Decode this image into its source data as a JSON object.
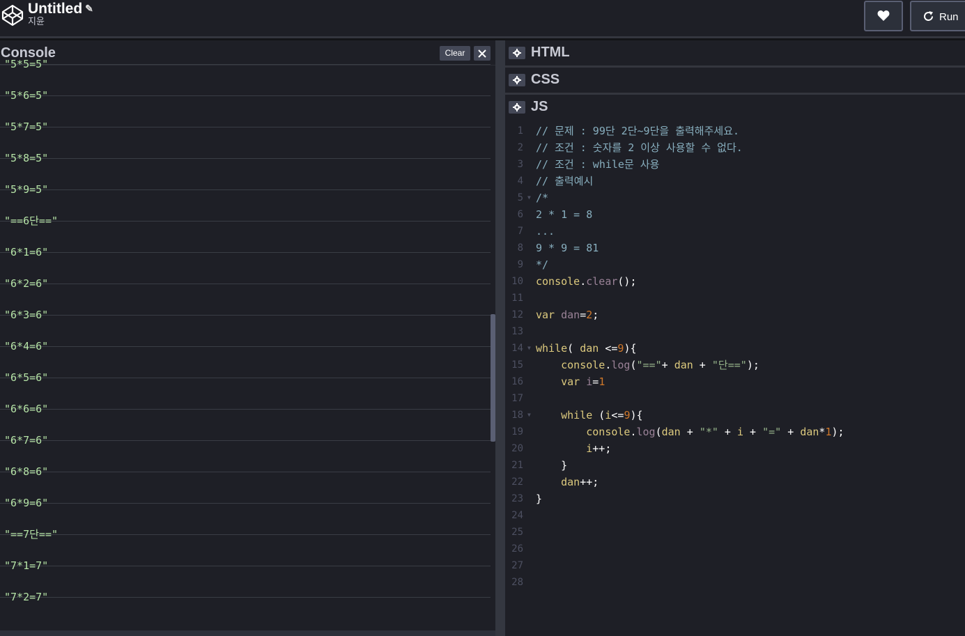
{
  "header": {
    "title": "Untitled",
    "author": "지윤",
    "run_label": "Run"
  },
  "console": {
    "title": "Console",
    "clear_label": "Clear",
    "logs": [
      "\"5*5=5\"",
      "\"5*6=5\"",
      "\"5*7=5\"",
      "\"5*8=5\"",
      "\"5*9=5\"",
      "\"==6단==\"",
      "\"6*1=6\"",
      "\"6*2=6\"",
      "\"6*3=6\"",
      "\"6*4=6\"",
      "\"6*5=6\"",
      "\"6*6=6\"",
      "\"6*7=6\"",
      "\"6*8=6\"",
      "\"6*9=6\"",
      "\"==7단==\"",
      "\"7*1=7\"",
      "\"7*2=7\""
    ]
  },
  "editors": {
    "html_label": "HTML",
    "css_label": "CSS",
    "js_label": "JS"
  },
  "code_lines": [
    {
      "n": "1",
      "fold": false,
      "tokens": [
        {
          "c": "com",
          "t": "// 문제 : 99단 2단~9단을 출력해주세요."
        }
      ]
    },
    {
      "n": "2",
      "fold": false,
      "tokens": [
        {
          "c": "com",
          "t": "// 조건 : 숫자를 2 이상 사용할 수 없다."
        }
      ]
    },
    {
      "n": "3",
      "fold": false,
      "tokens": [
        {
          "c": "com",
          "t": "// 조건 : while문 사용"
        }
      ]
    },
    {
      "n": "4",
      "fold": false,
      "tokens": [
        {
          "c": "com",
          "t": "// 출력예시"
        }
      ]
    },
    {
      "n": "5",
      "fold": true,
      "tokens": [
        {
          "c": "com",
          "t": "/*"
        }
      ]
    },
    {
      "n": "6",
      "fold": false,
      "tokens": [
        {
          "c": "com",
          "t": "2 * 1 = 8"
        }
      ]
    },
    {
      "n": "7",
      "fold": false,
      "tokens": [
        {
          "c": "com",
          "t": "..."
        }
      ]
    },
    {
      "n": "8",
      "fold": false,
      "tokens": [
        {
          "c": "com",
          "t": "9 * 9 = 81"
        }
      ]
    },
    {
      "n": "9",
      "fold": false,
      "tokens": [
        {
          "c": "com",
          "t": "*/"
        }
      ]
    },
    {
      "n": "10",
      "fold": false,
      "tokens": [
        {
          "c": "var",
          "t": "console"
        },
        {
          "c": "plain",
          "t": "."
        },
        {
          "c": "prop",
          "t": "clear"
        },
        {
          "c": "plain",
          "t": "();"
        }
      ]
    },
    {
      "n": "11",
      "fold": false,
      "tokens": []
    },
    {
      "n": "12",
      "fold": false,
      "tokens": [
        {
          "c": "kw",
          "t": "var "
        },
        {
          "c": "prop",
          "t": "dan"
        },
        {
          "c": "plain",
          "t": "="
        },
        {
          "c": "num",
          "t": "2"
        },
        {
          "c": "plain",
          "t": ";"
        }
      ]
    },
    {
      "n": "13",
      "fold": false,
      "tokens": []
    },
    {
      "n": "14",
      "fold": true,
      "tokens": [
        {
          "c": "kw",
          "t": "while"
        },
        {
          "c": "plain",
          "t": "( "
        },
        {
          "c": "var",
          "t": "dan"
        },
        {
          "c": "plain",
          "t": " <="
        },
        {
          "c": "num",
          "t": "9"
        },
        {
          "c": "plain",
          "t": "){"
        }
      ]
    },
    {
      "n": "15",
      "fold": false,
      "tokens": [
        {
          "c": "plain",
          "t": "    "
        },
        {
          "c": "var",
          "t": "console"
        },
        {
          "c": "plain",
          "t": "."
        },
        {
          "c": "prop",
          "t": "log"
        },
        {
          "c": "plain",
          "t": "("
        },
        {
          "c": "str",
          "t": "\"==\""
        },
        {
          "c": "plain",
          "t": "+ "
        },
        {
          "c": "var",
          "t": "dan"
        },
        {
          "c": "plain",
          "t": " + "
        },
        {
          "c": "str",
          "t": "\"단==\""
        },
        {
          "c": "plain",
          "t": ");"
        }
      ]
    },
    {
      "n": "16",
      "fold": false,
      "tokens": [
        {
          "c": "plain",
          "t": "    "
        },
        {
          "c": "kw",
          "t": "var "
        },
        {
          "c": "prop",
          "t": "i"
        },
        {
          "c": "plain",
          "t": "="
        },
        {
          "c": "num",
          "t": "1"
        }
      ]
    },
    {
      "n": "17",
      "fold": false,
      "tokens": []
    },
    {
      "n": "18",
      "fold": true,
      "tokens": [
        {
          "c": "plain",
          "t": "    "
        },
        {
          "c": "kw",
          "t": "while"
        },
        {
          "c": "plain",
          "t": " ("
        },
        {
          "c": "var",
          "t": "i"
        },
        {
          "c": "plain",
          "t": "<="
        },
        {
          "c": "num",
          "t": "9"
        },
        {
          "c": "plain",
          "t": "){"
        }
      ]
    },
    {
      "n": "19",
      "fold": false,
      "tokens": [
        {
          "c": "plain",
          "t": "        "
        },
        {
          "c": "var",
          "t": "console"
        },
        {
          "c": "plain",
          "t": "."
        },
        {
          "c": "prop",
          "t": "log"
        },
        {
          "c": "plain",
          "t": "("
        },
        {
          "c": "var",
          "t": "dan"
        },
        {
          "c": "plain",
          "t": " + "
        },
        {
          "c": "str",
          "t": "\"*\""
        },
        {
          "c": "plain",
          "t": " + "
        },
        {
          "c": "var",
          "t": "i"
        },
        {
          "c": "plain",
          "t": " + "
        },
        {
          "c": "str",
          "t": "\"=\""
        },
        {
          "c": "plain",
          "t": " + "
        },
        {
          "c": "var",
          "t": "dan"
        },
        {
          "c": "plain",
          "t": "*"
        },
        {
          "c": "num",
          "t": "1"
        },
        {
          "c": "plain",
          "t": ");"
        }
      ]
    },
    {
      "n": "20",
      "fold": false,
      "tokens": [
        {
          "c": "plain",
          "t": "        "
        },
        {
          "c": "var",
          "t": "i"
        },
        {
          "c": "plain",
          "t": "++;"
        }
      ]
    },
    {
      "n": "21",
      "fold": false,
      "tokens": [
        {
          "c": "plain",
          "t": "    }"
        }
      ]
    },
    {
      "n": "22",
      "fold": false,
      "tokens": [
        {
          "c": "plain",
          "t": "    "
        },
        {
          "c": "var",
          "t": "dan"
        },
        {
          "c": "plain",
          "t": "++;"
        }
      ]
    },
    {
      "n": "23",
      "fold": false,
      "tokens": [
        {
          "c": "plain",
          "t": "}"
        }
      ]
    },
    {
      "n": "24",
      "fold": false,
      "tokens": []
    },
    {
      "n": "25",
      "fold": false,
      "tokens": []
    },
    {
      "n": "26",
      "fold": false,
      "tokens": []
    },
    {
      "n": "27",
      "fold": false,
      "tokens": []
    },
    {
      "n": "28",
      "fold": false,
      "tokens": []
    }
  ]
}
